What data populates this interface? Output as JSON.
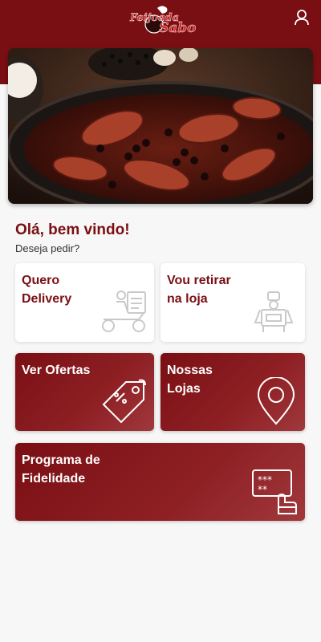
{
  "header": {
    "logo_text_1": "Feijoada",
    "logo_text_2": "Sabor",
    "user_icon": "user-icon",
    "brand_color": "#7a0f13"
  },
  "hero": {
    "image": "feijoada-dish-photo"
  },
  "greeting": {
    "title": "Olá, bem vindo!",
    "subtitle": "Deseja pedir?"
  },
  "cards": {
    "delivery": {
      "label": "Quero\nDelivery",
      "icon": "delivery-scooter-icon"
    },
    "pickup": {
      "label": "Vou retirar\nna loja",
      "icon": "store-counter-icon"
    },
    "offers": {
      "label": "Ver Ofertas",
      "icon": "price-tag-icon"
    },
    "stores": {
      "label": "Nossas\nLojas",
      "icon": "location-pin-icon"
    },
    "loyalty": {
      "label": "Programa de\nFidelidade",
      "icon": "loyalty-card-icon"
    }
  }
}
